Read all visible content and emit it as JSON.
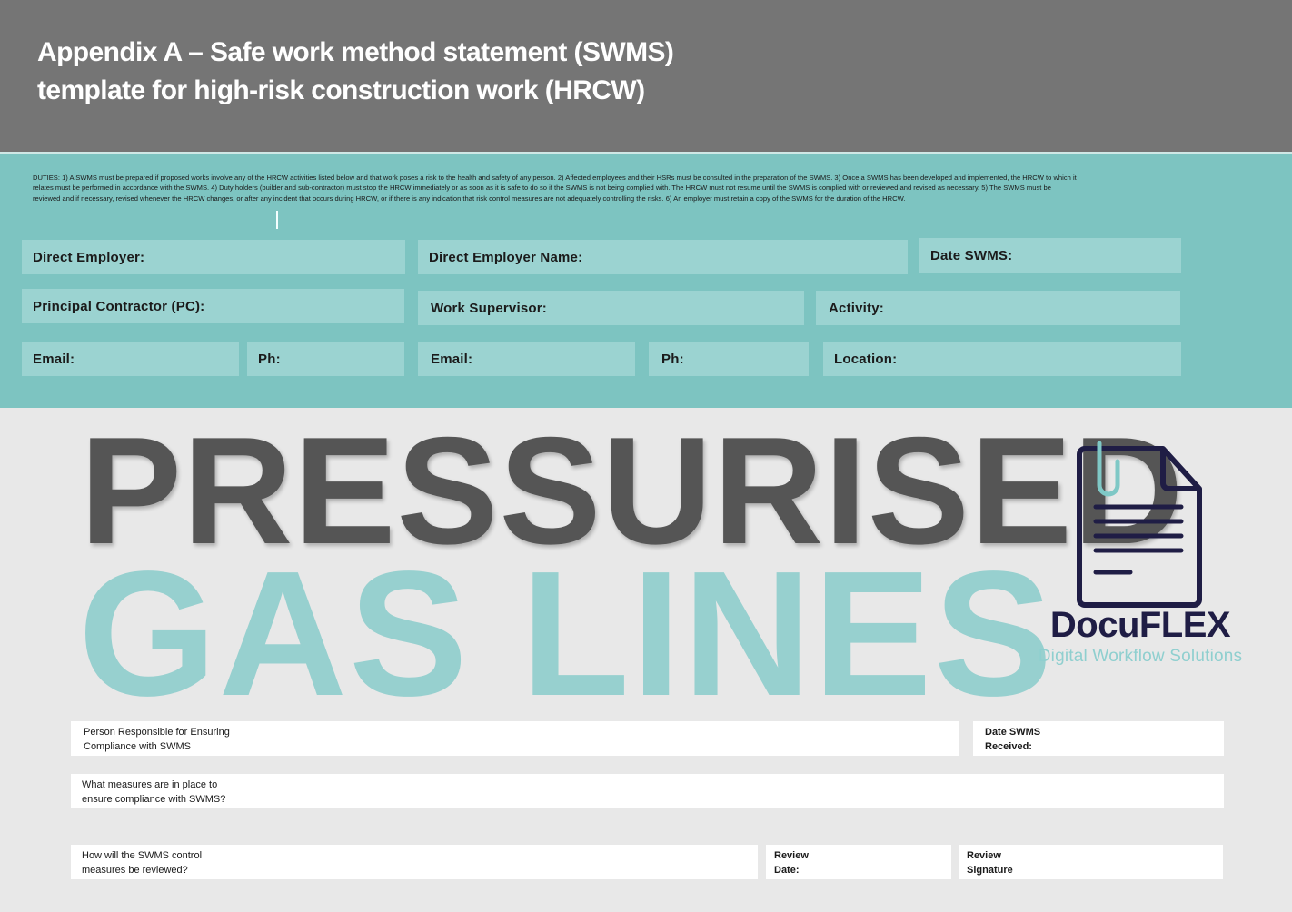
{
  "header": {
    "title_line1": "Appendix A – Safe work method statement (SWMS)",
    "title_line2": "template for high-risk construction work (HRCW)"
  },
  "duties": {
    "text": "DUTIES: 1) A SWMS must be prepared if proposed works involve any of the HRCW activities listed below and that work poses a risk to the health and safety of any person. 2) Affected employees and their HSRs must be consulted in the preparation of the SWMS. 3) Once a SWMS has been developed and implemented, the HRCW to which it relates must be performed in accordance with the SWMS. 4) Duty holders (builder and sub-contractor) must stop the HRCW immediately or as soon as it is safe to do so if the SWMS is not being complied with. The HRCW must not resume until the SWMS is complied with or reviewed and revised as necessary. 5) The SWMS must be reviewed and if necessary, revised whenever the HRCW changes, or after any incident that occurs during HRCW, or if there is any indication that risk control measures are not adequately controlling the risks. 6) An employer must retain a copy of the SWMS for the duration of the HRCW."
  },
  "fields": {
    "direct_employer": "Direct Employer:",
    "direct_employer_name": "Direct Employer Name:",
    "date_swms": "Date SWMS:",
    "principal_contractor": "Principal Contractor (PC):",
    "work_supervisor": "Work Supervisor:",
    "activity": "Activity:",
    "pc_email": "Email:",
    "pc_phone": "Ph:",
    "supervisor_email": "Email:",
    "supervisor_phone": "Ph:",
    "location": "Location:"
  },
  "title": {
    "line1": "PRESSURISED",
    "line2": "GAS LINES"
  },
  "logo": {
    "name": "DocuFLEX",
    "tagline": "Digital Workflow Solutions",
    "icon": "document-with-paperclip-icon"
  },
  "compliance": {
    "person_responsible_l1": "Person Responsible for Ensuring",
    "person_responsible_l2": "Compliance with SWMS",
    "date_received_l1": "Date SWMS",
    "date_received_l2": "Received:",
    "measures_l1": "What measures are in place to",
    "measures_l2": "ensure compliance with SWMS?",
    "review_how_l1": "How will the SWMS control",
    "review_how_l2": "measures be reviewed?",
    "review_date_l1": "Review",
    "review_date_l2": "Date:",
    "review_signature_l1": "Review",
    "review_signature_l2": "Signature"
  },
  "colors": {
    "header_bg": "#757575",
    "teal_panel": "#7dc4c1",
    "field_bg": "#9bd3d1",
    "title_dark": "#555555",
    "title_teal": "#97d0cf",
    "logo_navy": "#1f1d45",
    "page_bg": "#e8e8e8"
  }
}
